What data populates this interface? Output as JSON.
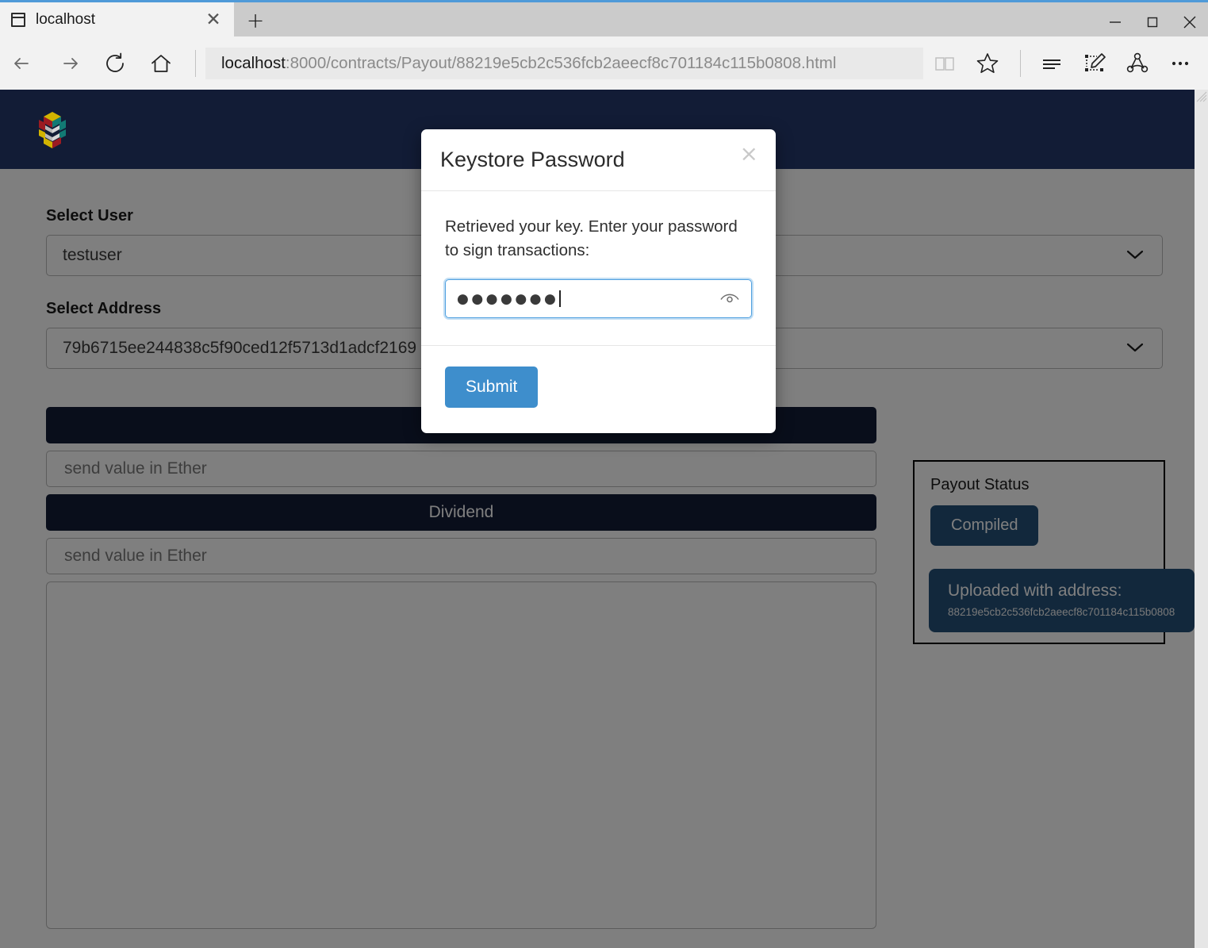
{
  "browser": {
    "tab": {
      "title": "localhost",
      "favicon_icon": "browser-window-icon",
      "close_icon": "close-icon"
    },
    "new_tab_label": "+",
    "window_controls": {
      "minimize": "minimize-icon",
      "maximize": "maximize-icon",
      "close": "close-icon"
    },
    "nav": {
      "back_icon": "back-arrow-icon",
      "forward_icon": "forward-arrow-icon",
      "refresh_icon": "refresh-icon",
      "home_icon": "home-icon",
      "url_host": "localhost",
      "url_rest": ":8000/contracts/Payout/88219e5cb2c536fcb2aeecf8c701184c115b0808.html",
      "url_full": "localhost:8000/contracts/Payout/88219e5cb2c536fcb2aeecf8c701184c115b0808.html",
      "reading_view_icon": "book-icon",
      "favorites_icon": "star-icon",
      "hub_icon": "hub-lines-icon",
      "web_note_icon": "pencil-note-icon",
      "share_icon": "share-icon",
      "more_icon": "ellipsis-icon"
    }
  },
  "site": {
    "logo_icon": "isometric-cube-logo",
    "header_bg": "#121c36"
  },
  "form": {
    "user_label": "Select User",
    "user_value": "testuser",
    "address_label": "Select Address",
    "address_value": "79b6715ee244838c5f90ced12f5713d1adcf2169",
    "dropdown_icon": "chevron-down-icon",
    "payout_button_label": "",
    "payout_value_placeholder": "send value in Ether",
    "dividend_button_label": "Dividend",
    "dividend_value_placeholder": "send value in Ether",
    "log_value": ""
  },
  "status": {
    "panel_title": "Payout Status",
    "compiled_label": "Compiled",
    "uploaded_label": "Uploaded with address:",
    "uploaded_address": "88219e5cb2c536fcb2aeecf8c701184c115b0808",
    "badge_color": "#245079"
  },
  "modal": {
    "title": "Keystore Password",
    "close_icon": "close-icon",
    "message": "Retrieved your key. Enter your password to sign transactions:",
    "password_masked": "●●●●●●●",
    "password_char_count": "7",
    "reveal_icon": "eye-icon",
    "submit_label": "Submit",
    "submit_color": "#3e8ecc"
  }
}
